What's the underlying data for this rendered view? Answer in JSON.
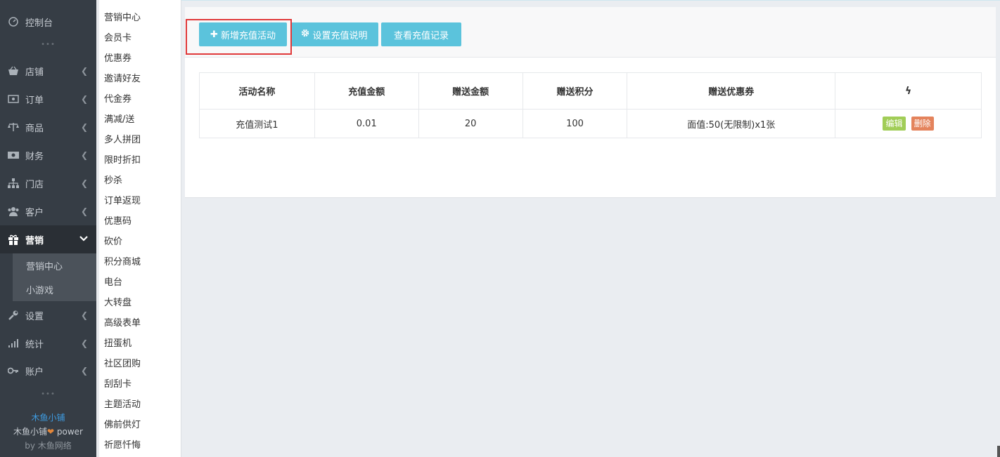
{
  "sidebar": {
    "items": [
      {
        "label": "控制台",
        "icon": "dashboard-icon"
      },
      {
        "label": "店铺",
        "icon": "basket-icon"
      },
      {
        "label": "订单",
        "icon": "money-icon"
      },
      {
        "label": "商品",
        "icon": "scale-icon"
      },
      {
        "label": "财务",
        "icon": "cash-icon"
      },
      {
        "label": "门店",
        "icon": "sitemap-icon"
      },
      {
        "label": "客户",
        "icon": "users-icon"
      },
      {
        "label": "营销",
        "icon": "gift-icon"
      },
      {
        "label": "设置",
        "icon": "wrench-icon"
      },
      {
        "label": "统计",
        "icon": "signal-icon"
      },
      {
        "label": "账户",
        "icon": "key-icon"
      }
    ],
    "sub_items": [
      "营销中心",
      "小游戏"
    ],
    "dots": "•••",
    "brand_name": "木鱼小铺",
    "brand_power_pre": "木鱼小铺",
    "brand_power_post": " power",
    "brand_by": "by 木鱼网络"
  },
  "submenu": {
    "items": [
      "营销中心",
      "会员卡",
      "优惠券",
      "邀请好友",
      "代金券",
      "满减/送",
      "多人拼团",
      "限时折扣",
      "秒杀",
      "订单返现",
      "优惠码",
      "砍价",
      "积分商城",
      "电台",
      "大转盘",
      "高级表单",
      "扭蛋机",
      "社区团购",
      "刮刮卡",
      "主题活动",
      "佛前供灯",
      "祈愿忏悔"
    ]
  },
  "toolbar": {
    "add_label": "新增充值活动",
    "settings_label": "设置充值说明",
    "records_label": "查看充值记录"
  },
  "table": {
    "headers": [
      "活动名称",
      "充值金额",
      "赠送金额",
      "赠送积分",
      "赠送优惠券",
      "ϟ"
    ],
    "rows": [
      {
        "name": "充值测试1",
        "amount": "0.01",
        "bonus": "20",
        "points": "100",
        "coupon": "面值:50(无限制)x1张",
        "edit": "编辑",
        "delete": "删除"
      }
    ]
  },
  "colors": {
    "sidebar_bg": "#363d45",
    "accent_button": "#5bc3dc",
    "highlight_border": "#e0393a",
    "edit_tag": "#a1cd57",
    "delete_tag": "#e4835c",
    "brand_blue": "#3e9be0"
  }
}
